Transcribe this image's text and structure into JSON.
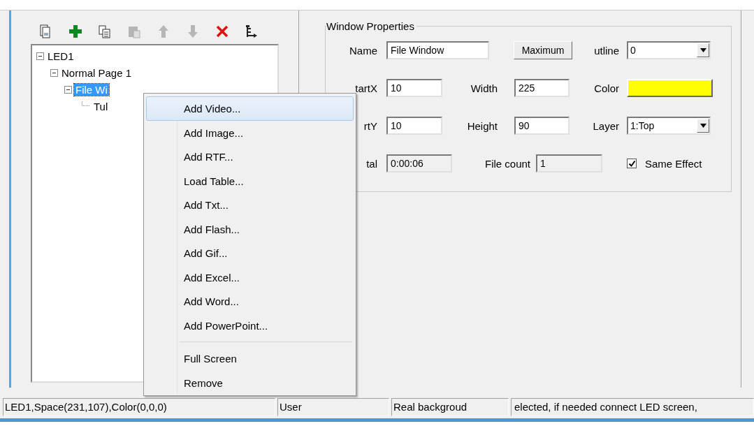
{
  "toolbar": [
    {
      "kind": "pages",
      "disabled": false
    },
    {
      "kind": "plus",
      "disabled": false
    },
    {
      "kind": "copy",
      "disabled": false
    },
    {
      "kind": "paste",
      "disabled": true
    },
    {
      "kind": "up",
      "disabled": true
    },
    {
      "kind": "down",
      "disabled": true
    },
    {
      "kind": "delete",
      "disabled": false
    },
    {
      "kind": "tree",
      "disabled": false
    }
  ],
  "tree": [
    {
      "label": "LED1",
      "expanded": true,
      "selected": false,
      "children": [
        {
          "label": "Normal Page 1",
          "expanded": true,
          "selected": false,
          "children": [
            {
              "label": "File Wi",
              "expanded": true,
              "selected": true,
              "children": [
                {
                  "label": "Tul",
                  "selected": false
                }
              ]
            }
          ]
        }
      ]
    }
  ],
  "window_properties": {
    "title": "Window Properties",
    "name": {
      "label": "Name",
      "value": "File Window"
    },
    "maximum_button": "Maximum",
    "outline": {
      "label": "utline",
      "value": "0"
    },
    "start_x": {
      "label": "tartX",
      "value": "10"
    },
    "width": {
      "label": "Width",
      "value": "225"
    },
    "color": {
      "label": "Color",
      "color": "#ffff00"
    },
    "start_y": {
      "label": "rtY",
      "value": "10"
    },
    "height": {
      "label": "Height",
      "value": "90"
    },
    "layer": {
      "label": "Layer",
      "value": "1:Top"
    },
    "total": {
      "label": "tal",
      "value": "0:00:06",
      "disabled": true
    },
    "file_count": {
      "label": "File count",
      "value": "1",
      "disabled": true
    },
    "same_effect": {
      "label": "Same Effect",
      "checked": true
    }
  },
  "context_menu": {
    "groups": [
      [
        {
          "label": "Add Video...",
          "selected": true
        },
        {
          "label": "Add Image...",
          "selected": false
        },
        {
          "label": "Add RTF...",
          "selected": false
        },
        {
          "label": "Load Table...",
          "selected": false
        },
        {
          "label": "Add Txt...",
          "selected": false
        },
        {
          "label": "Add Flash...",
          "selected": false
        },
        {
          "label": "Add Gif...",
          "selected": false
        },
        {
          "label": "Add Excel...",
          "selected": false
        },
        {
          "label": "Add Word...",
          "selected": false
        },
        {
          "label": "Add PowerPoint...",
          "selected": false
        }
      ],
      [
        {
          "label": "Full Screen",
          "selected": false
        },
        {
          "label": "Remove",
          "selected": false
        }
      ]
    ]
  },
  "status_bar": [
    "LED1,Space(231,107),Color(0,0,0)",
    "User",
    "Real backgroud",
    "elected, if needed connect LED screen,"
  ]
}
